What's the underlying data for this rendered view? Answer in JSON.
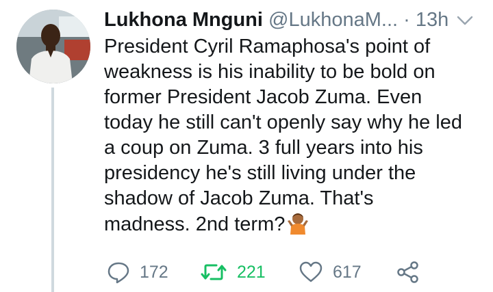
{
  "tweet": {
    "author_name": "Lukhona Mnguni",
    "author_handle": "@LukhonaM...",
    "separator": "·",
    "time": "13h",
    "text_lines": [
      "President Cyril Ramaphosa's point of",
      "weakness is his inability to be bold on",
      "former President Jacob Zuma. Even",
      "today he still can't openly say why he led",
      "a coup on Zuma. 3 full years into his",
      "presidency he's still living under the",
      "shadow of Jacob Zuma. That's",
      "madness. 2nd term?"
    ],
    "emoji": "person-shrugging-emoji"
  },
  "actions": {
    "reply_count": "172",
    "retweet_count": "221",
    "like_count": "617"
  },
  "icons": {
    "reply": "reply-icon",
    "retweet": "retweet-icon",
    "like": "heart-icon",
    "share": "share-icon",
    "menu": "chevron-down-icon"
  },
  "colors": {
    "text": "#14171a",
    "muted": "#657786",
    "retweet_active": "#17bf63",
    "thread_line": "#cfd9de"
  }
}
